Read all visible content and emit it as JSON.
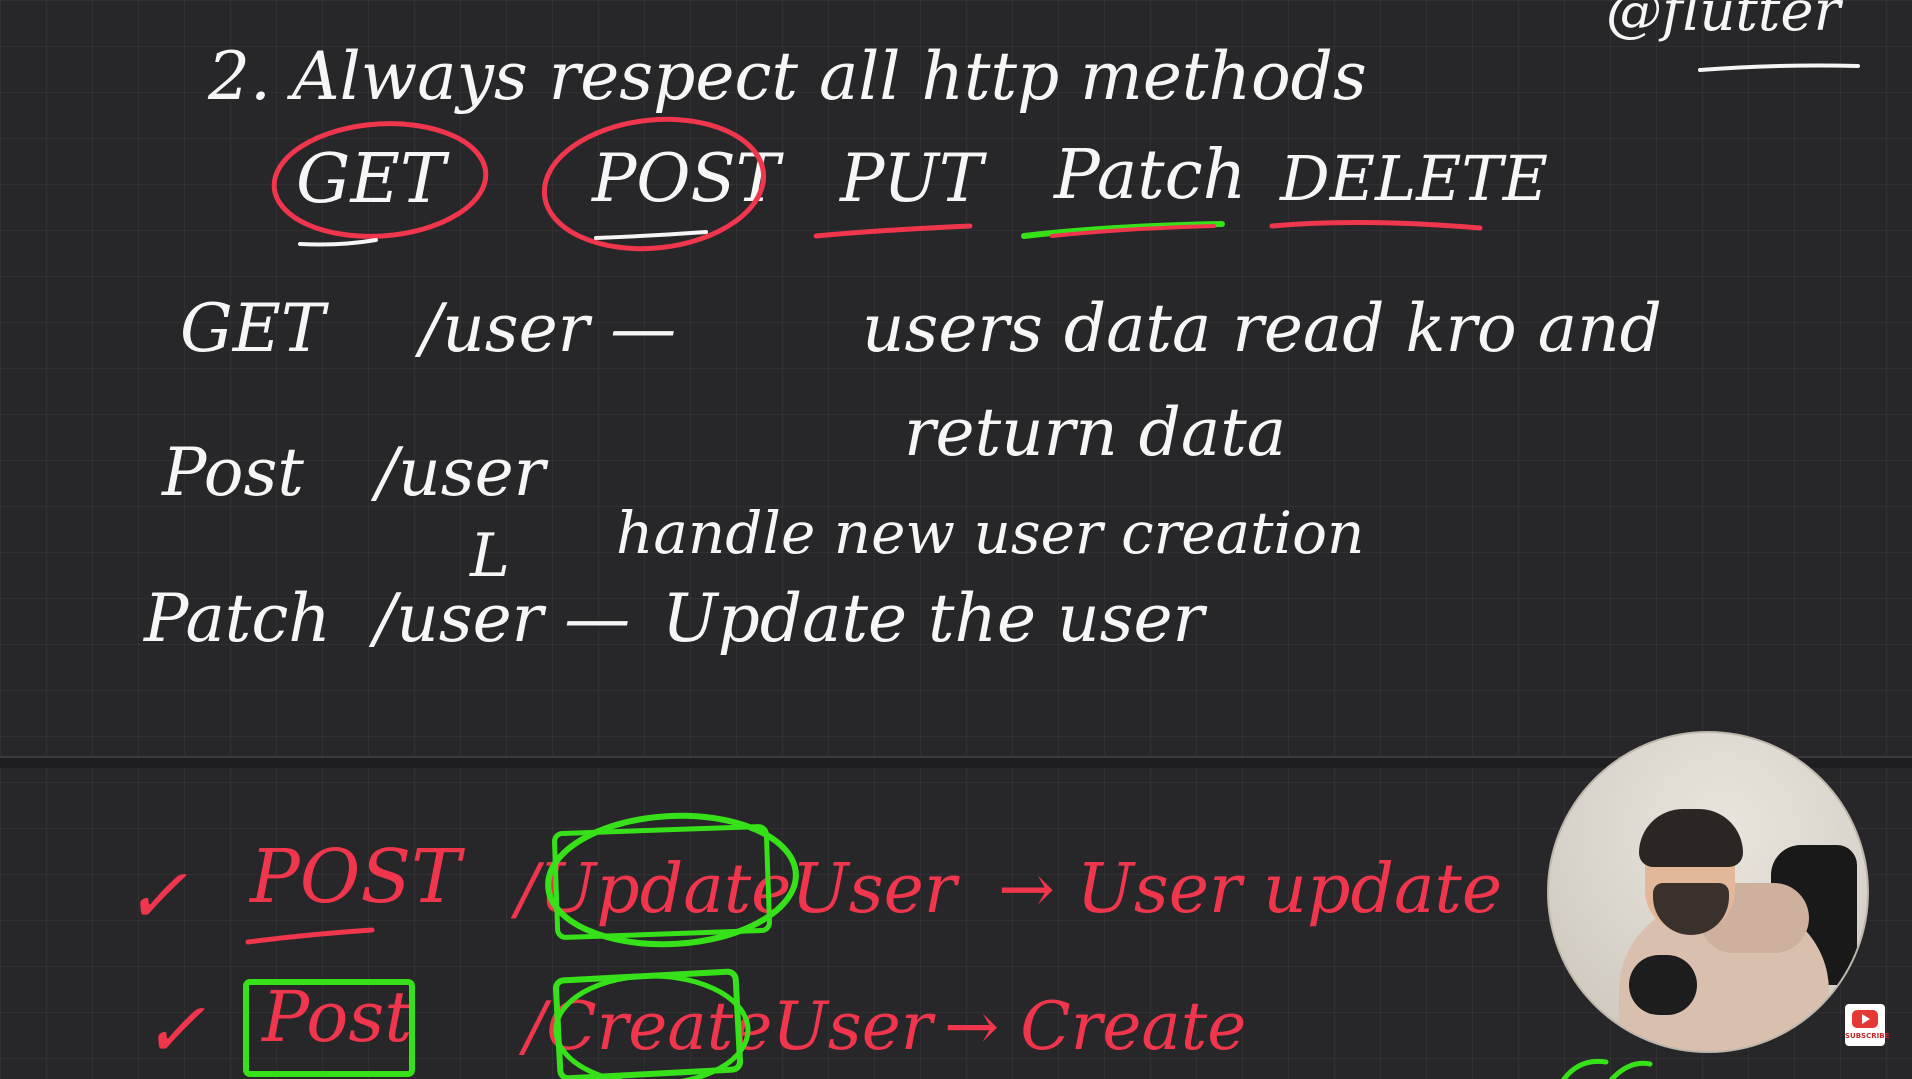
{
  "corner_tag": "@flutter",
  "heading": "2. Always respect all http methods",
  "methods": [
    "GET",
    "POST",
    "PUT",
    "Patch",
    "DELETE"
  ],
  "lines": [
    {
      "verb": "GET",
      "path": "/user —",
      "desc": "users data read kro and"
    },
    {
      "verb": "",
      "path": "",
      "desc": "return data"
    },
    {
      "verb": "Post",
      "path": "/user",
      "desc": ""
    },
    {
      "verb": "",
      "path": "L",
      "desc": "handle new user creation"
    },
    {
      "verb": "Patch",
      "path": "/user —",
      "desc": "Update the user"
    }
  ],
  "bottom": [
    {
      "check": "✓",
      "verb": "POST",
      "path": "/UpdateUser",
      "result": "→ User update"
    },
    {
      "check": "✓",
      "verb": "Post",
      "path": "/CreateUser",
      "result": "→ Create"
    }
  ],
  "youtube_badge": "SUBSCRIBE",
  "colors": {
    "chalk": "#f6f6f6",
    "red": "#f0364d",
    "green": "#37e11a",
    "board": "#272628"
  }
}
